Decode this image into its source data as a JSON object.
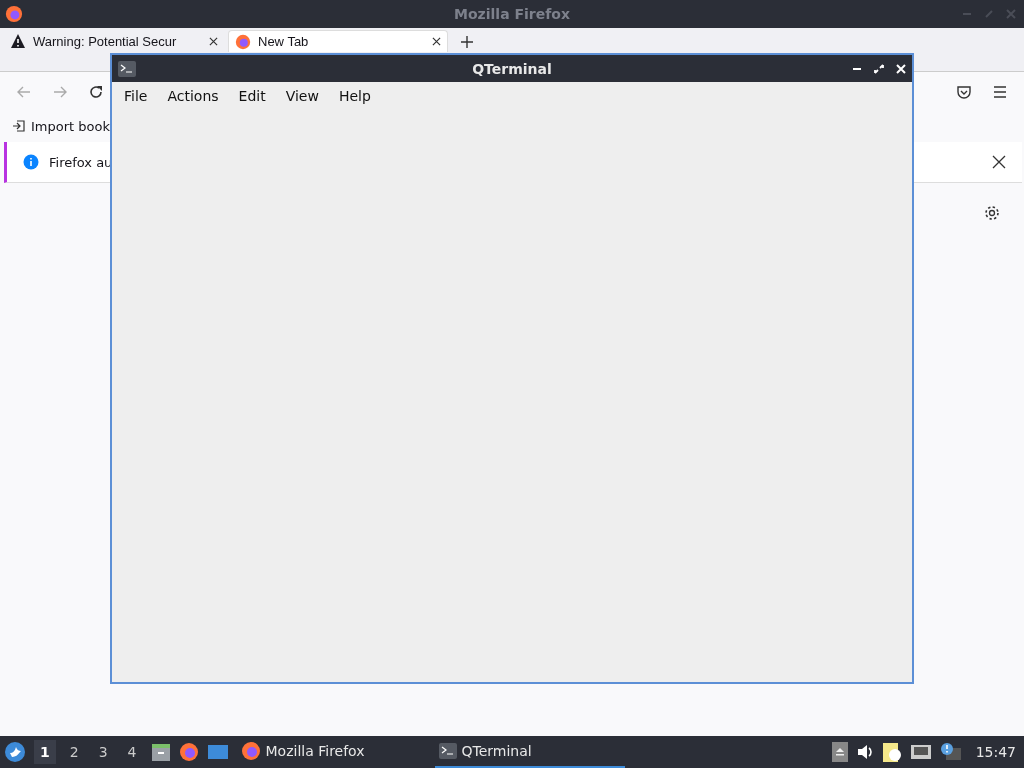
{
  "firefox": {
    "title": "Mozilla Firefox",
    "tabs": [
      {
        "label": "Warning: Potential Secur",
        "selected": false
      },
      {
        "label": "New Tab",
        "selected": true
      }
    ],
    "bookmarks": [
      "Import book"
    ],
    "notification": "Firefox au"
  },
  "terminal": {
    "title": "QTerminal",
    "menus": [
      "File",
      "Actions",
      "Edit",
      "View",
      "Help"
    ]
  },
  "taskbar": {
    "workspaces": [
      {
        "label": "1",
        "selected": true
      },
      {
        "label": "2",
        "selected": false
      },
      {
        "label": "3",
        "selected": false
      },
      {
        "label": "4",
        "selected": false
      }
    ],
    "tasks": [
      {
        "label": "Mozilla Firefox",
        "selected": false
      },
      {
        "label": "QTerminal",
        "selected": true
      }
    ],
    "clock": "15:47"
  }
}
